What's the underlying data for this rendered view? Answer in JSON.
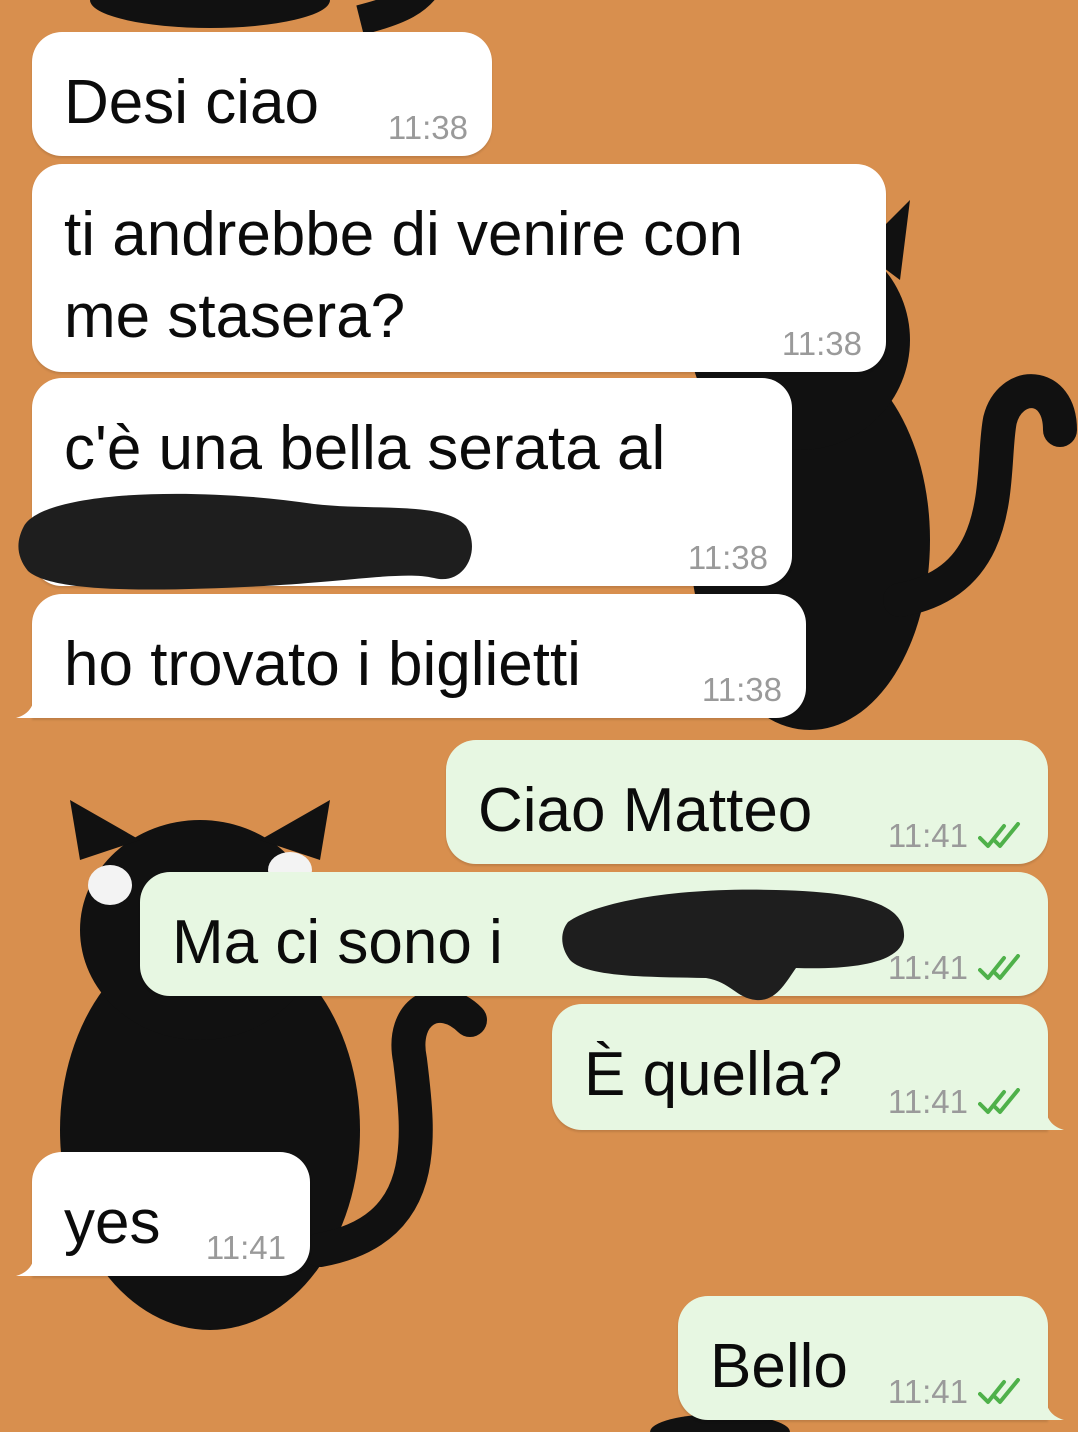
{
  "colors": {
    "wallpaper": "#d88f4e",
    "incoming_bubble": "#ffffff",
    "outgoing_bubble": "#e7f7e2",
    "timestamp": "#9a9a9a",
    "read_check": "#4fb14a",
    "redaction": "#1e1e1e"
  },
  "icons": {
    "read_receipt": "double-check-icon",
    "wallpaper": "black-cat-illustration"
  },
  "messages": [
    {
      "direction": "incoming",
      "lines": [
        "Desi ciao"
      ],
      "time": "11:38"
    },
    {
      "direction": "incoming",
      "lines": [
        "ti andrebbe di venire con",
        "me stasera?"
      ],
      "time": "11:38"
    },
    {
      "direction": "incoming",
      "lines": [
        "c'è una bella serata al"
      ],
      "time": "11:38",
      "redacted": true
    },
    {
      "direction": "incoming",
      "lines": [
        "ho trovato i biglietti"
      ],
      "time": "11:38"
    },
    {
      "direction": "outgoing",
      "lines": [
        "Ciao Matteo"
      ],
      "time": "11:41",
      "status": "read"
    },
    {
      "direction": "outgoing",
      "lines": [
        "Ma ci sono i"
      ],
      "time": "11:41",
      "status": "read",
      "redacted": true
    },
    {
      "direction": "outgoing",
      "lines": [
        "È quella?"
      ],
      "time": "11:41",
      "status": "read"
    },
    {
      "direction": "incoming",
      "lines": [
        "yes"
      ],
      "time": "11:41"
    },
    {
      "direction": "outgoing",
      "lines": [
        "Bello"
      ],
      "time": "11:41",
      "status": "read"
    }
  ]
}
